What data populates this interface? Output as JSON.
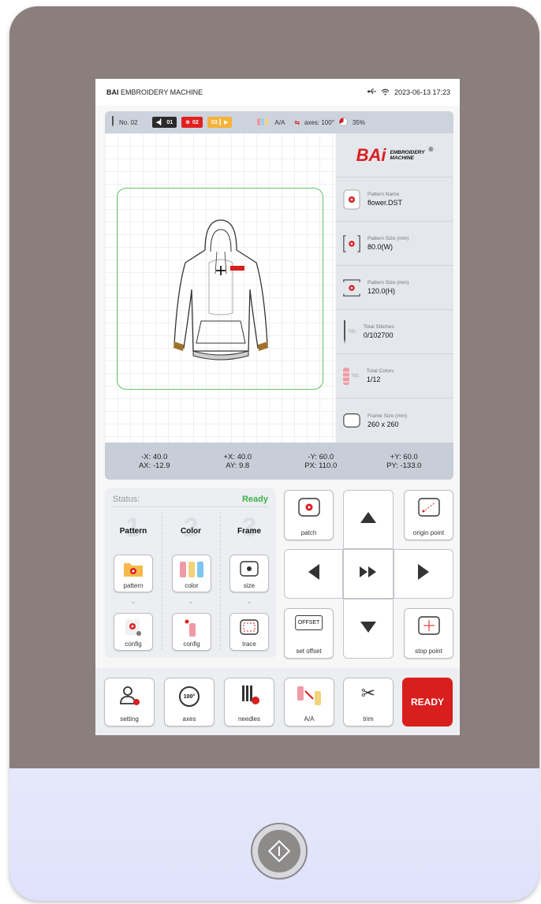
{
  "topbar": {
    "brand_bold": "BAI",
    "brand_rest": " EMBROIDERY MACHINE",
    "datetime": "2023-06-13 17:23"
  },
  "statusbar": {
    "needle_no": "No. 02",
    "chip1": "01",
    "chip2": "02",
    "chip3": "03",
    "aa": "A/A",
    "axes": "axes: 100°",
    "percent": "35%"
  },
  "info": {
    "logo_text": "BAi",
    "logo_line1": "EMBROIDERY",
    "logo_line2": "MACHINE",
    "rows": [
      {
        "label": "Pattern Name",
        "value": "flower.DST",
        "icon": "pattern-icon"
      },
      {
        "label": "Pattern Size (mm)",
        "value": "80.0(W)",
        "icon": "width-icon"
      },
      {
        "label": "Pattern Size (mm)",
        "value": "120.0(H)",
        "icon": "height-icon"
      },
      {
        "label": "Total Stitches",
        "value": "0/102700",
        "icon": "needle-icon",
        "prefix": "No."
      },
      {
        "label": "Total Colors",
        "value": "1/12",
        "icon": "spool-icon",
        "prefix": "No."
      },
      {
        "label": "Frame Size (mm)",
        "value": "260 x 260",
        "icon": "frame-icon"
      }
    ]
  },
  "coords": {
    "mx": "-X: 40.0",
    "px": "+X: 40.0",
    "my": "-Y: 60.0",
    "py": "+Y: 60.0",
    "ax": "AX: -12.9",
    "ay": "AY: 9.8",
    "pxv": "PX: 110.0",
    "pyv": "PY: -133.0"
  },
  "status": {
    "label": "Status:",
    "value": "Ready"
  },
  "steps": [
    {
      "num": "1",
      "title": "Pattern",
      "btn1": "pattern",
      "btn2": "config"
    },
    {
      "num": "2",
      "title": "Color",
      "btn1": "color",
      "btn2": "config"
    },
    {
      "num": "3",
      "title": "Frame",
      "btn1": "size",
      "btn2": "trace"
    }
  ],
  "controls": {
    "patch": "patch",
    "origin_point": "origin point",
    "set_offset": "set offset",
    "offset_text": "OFFSET",
    "stop_point": "stop point"
  },
  "bottombar": {
    "setting": "setting",
    "axes": "axes",
    "axes_icon_text": "100°",
    "needles": "needles",
    "aa": "A/A",
    "trim": "trim",
    "ready": "READY"
  },
  "colors": {
    "accent_red": "#d91e1e",
    "ready_green": "#3fb24a",
    "frame_green": "#69c06a"
  }
}
